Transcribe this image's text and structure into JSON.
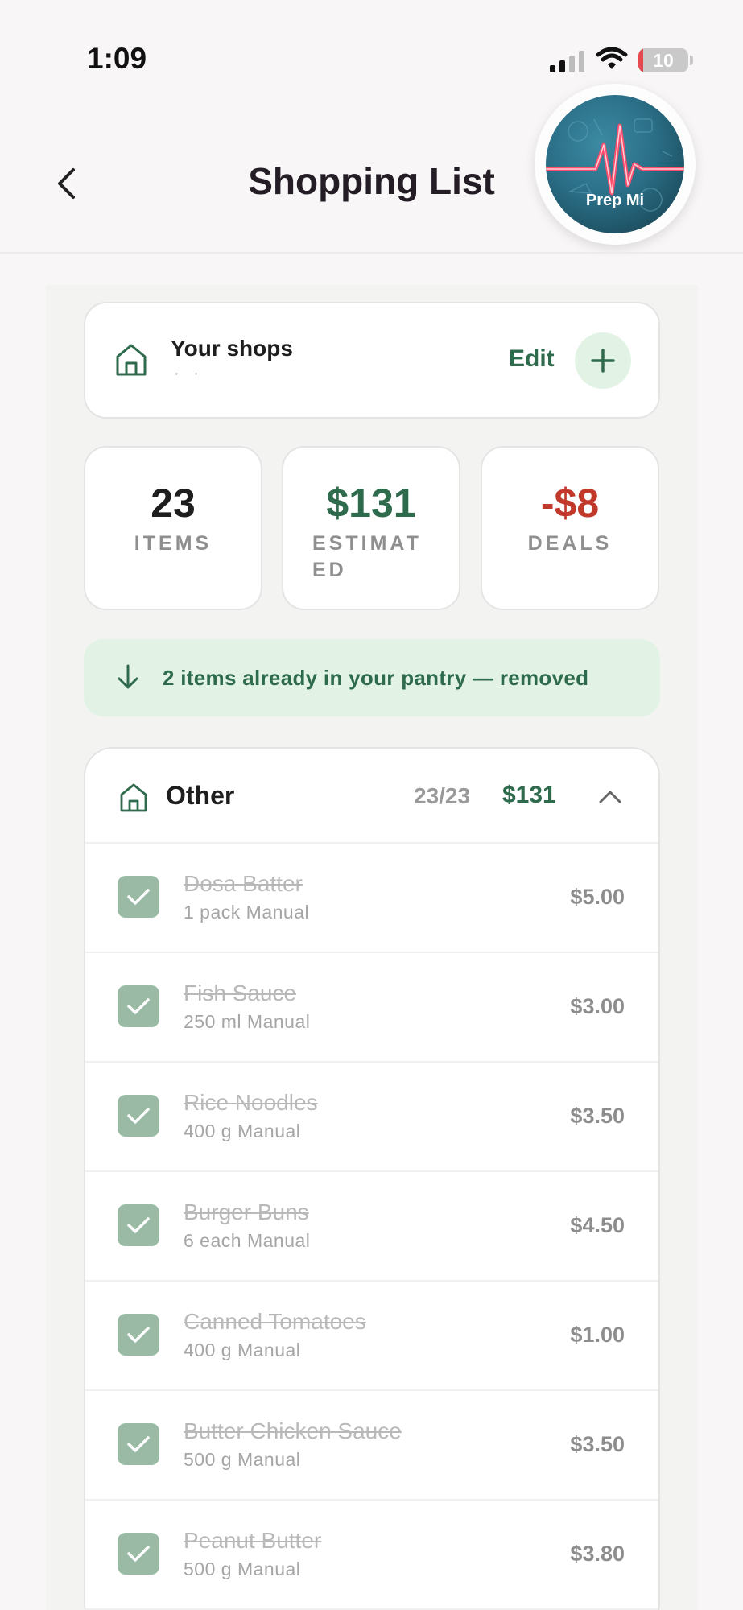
{
  "status_bar": {
    "time": "1:09",
    "battery_level": "10",
    "battery_percent": 10,
    "battery_color": "#e5484d"
  },
  "header": {
    "title": "Shopping List",
    "back_icon": "chevron-left-icon",
    "logo_text": "Prep Mi"
  },
  "shops": {
    "title": "Your shops",
    "subtitle": "· ·",
    "edit_label": "Edit",
    "add_icon": "plus-icon"
  },
  "stats": {
    "items_value": "23",
    "items_label": "ITEMS",
    "estimated_value": "$131",
    "estimated_label": "ESTIMAT ED",
    "deals_value": "-$8",
    "deals_label": "DEALS"
  },
  "pantry_notice": {
    "icon": "arrow-down-icon",
    "text": "2 items already in your pantry — removed"
  },
  "group": {
    "name": "Other",
    "count": "23/23",
    "total": "$131",
    "toggle_icon": "chevron-up-icon"
  },
  "items": [
    {
      "name": "Dosa Batter",
      "meta": "1 pack Manual",
      "price": "$5.00",
      "checked": true
    },
    {
      "name": "Fish Sauce",
      "meta": "250 ml Manual",
      "price": "$3.00",
      "checked": true
    },
    {
      "name": "Rice Noodles",
      "meta": "400 g Manual",
      "price": "$3.50",
      "checked": true
    },
    {
      "name": "Burger Buns",
      "meta": "6 each Manual",
      "price": "$4.50",
      "checked": true
    },
    {
      "name": "Canned Tomatoes",
      "meta": "400 g Manual",
      "price": "$1.00",
      "checked": true
    },
    {
      "name": "Butter Chicken Sauce",
      "meta": "500 g Manual",
      "price": "$3.50",
      "checked": true
    },
    {
      "name": "Peanut Butter",
      "meta": "500 g Manual",
      "price": "$3.80",
      "checked": true
    }
  ],
  "colors": {
    "brand_green": "#2e6b4c",
    "deals_red": "#c0392b",
    "check_green": "#9bbaa6",
    "banner_green": "#e2f3e6"
  }
}
